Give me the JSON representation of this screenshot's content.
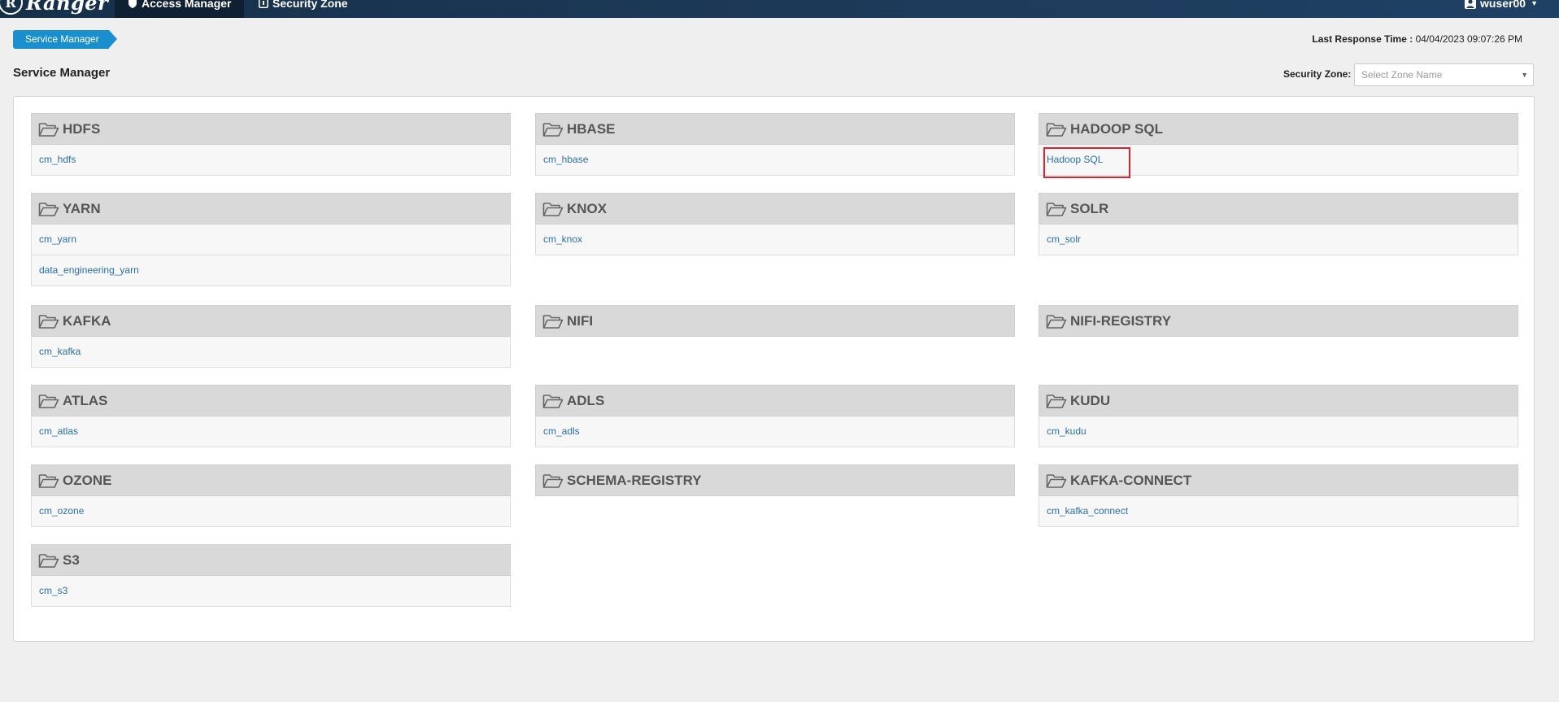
{
  "navbar": {
    "brand_letter": "R",
    "brand": "Ranger",
    "access_manager": "Access Manager",
    "security_zone": "Security Zone",
    "user": "wuser00"
  },
  "breadcrumb": "Service Manager",
  "last_response": {
    "label": "Last Response Time :",
    "value": "04/04/2023 09:07:26 PM"
  },
  "page_title": "Service Manager",
  "zone": {
    "label": "Security Zone:",
    "placeholder": "Select Zone Name"
  },
  "services": [
    {
      "name": "HDFS",
      "items": [
        "cm_hdfs"
      ]
    },
    {
      "name": "HBASE",
      "items": [
        "cm_hbase"
      ]
    },
    {
      "name": "HADOOP SQL",
      "items": [
        "Hadoop SQL"
      ]
    },
    {
      "name": "YARN",
      "items": [
        "cm_yarn",
        "data_engineering_yarn"
      ]
    },
    {
      "name": "KNOX",
      "items": [
        "cm_knox"
      ]
    },
    {
      "name": "SOLR",
      "items": [
        "cm_solr"
      ]
    },
    {
      "name": "KAFKA",
      "items": [
        "cm_kafka"
      ]
    },
    {
      "name": "NIFI",
      "items": []
    },
    {
      "name": "NIFI-REGISTRY",
      "items": []
    },
    {
      "name": "ATLAS",
      "items": [
        "cm_atlas"
      ]
    },
    {
      "name": "ADLS",
      "items": [
        "cm_adls"
      ]
    },
    {
      "name": "KUDU",
      "items": [
        "cm_kudu"
      ]
    },
    {
      "name": "OZONE",
      "items": [
        "cm_ozone"
      ]
    },
    {
      "name": "SCHEMA-REGISTRY",
      "items": []
    },
    {
      "name": "KAFKA-CONNECT",
      "items": [
        "cm_kafka_connect"
      ]
    },
    {
      "name": "S3",
      "items": [
        "cm_s3"
      ]
    }
  ],
  "colors": {
    "navbar": "#1d3b5a",
    "breadcrumb": "#1a8fcd",
    "link": "#2a6fa8",
    "highlight": "#e0202a"
  }
}
